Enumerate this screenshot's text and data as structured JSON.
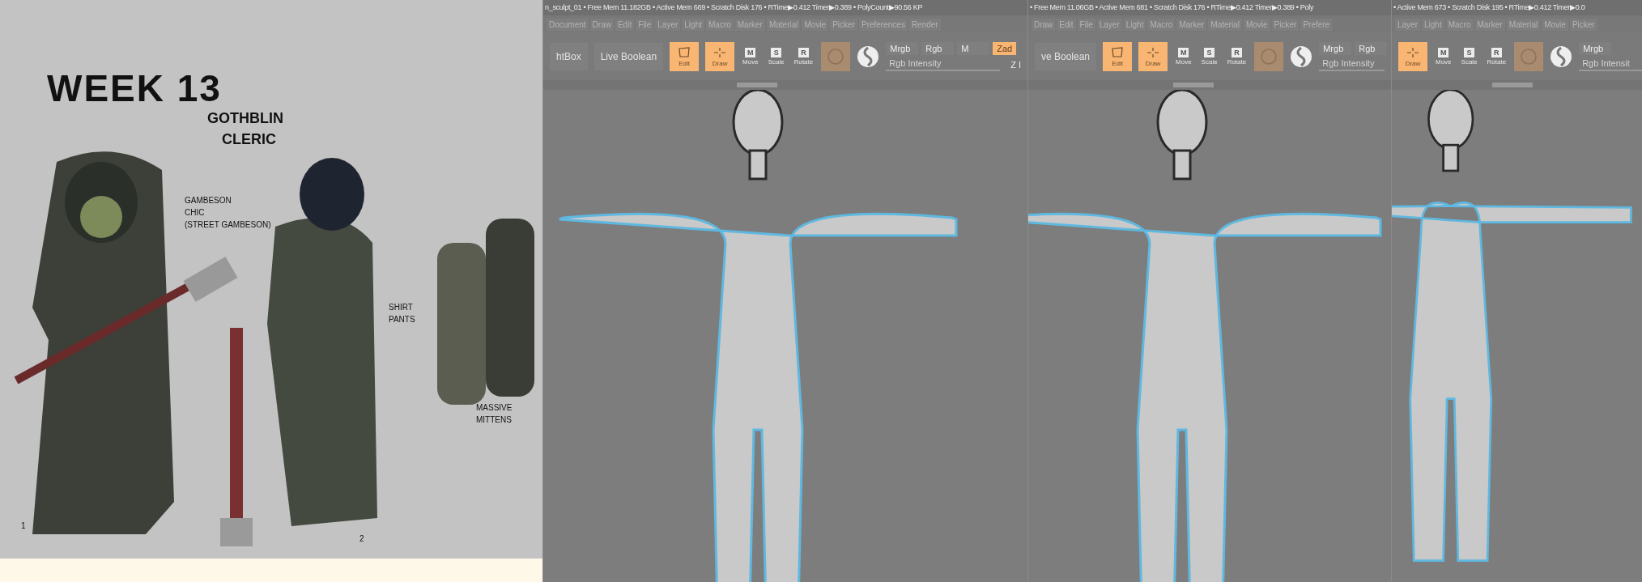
{
  "concept_art": {
    "title": "WEEK 13",
    "heading": [
      "GOTHBLIN",
      "CLERIC"
    ],
    "notes": [
      {
        "lines": [
          "GAMBESON",
          "CHIC",
          "(STREET GAMBESON)"
        ]
      },
      {
        "lines": [
          "SHIRT",
          "PANTS"
        ]
      },
      {
        "lines": [
          "MASSIVE",
          "MITTENS"
        ]
      },
      {
        "lines": [
          "1"
        ]
      },
      {
        "lines": [
          "2"
        ]
      }
    ]
  },
  "panels": [
    {
      "status": "n_sculpt_01  • Free Mem 11.182GB • Active Mem 669 • Scratch Disk 176 •  RTime▶0.412 Timer▶0.389 • PolyCount▶90.56 KP",
      "menu": [
        "Document",
        "Draw",
        "Edit",
        "File",
        "Layer",
        "Light",
        "Macro",
        "Marker",
        "Material",
        "Movie",
        "Picker",
        "Preferences",
        "Render"
      ],
      "tools": [
        {
          "kind": "textbutton",
          "label": "htBox"
        },
        {
          "kind": "textbutton",
          "label": "Live Boolean"
        },
        {
          "kind": "edit",
          "label": "Edit",
          "on": true
        },
        {
          "kind": "draw",
          "label": "Draw",
          "on": true
        },
        {
          "kind": "transform",
          "key": "M",
          "label": "Move"
        },
        {
          "kind": "transform",
          "key": "S",
          "label": "Scale"
        },
        {
          "kind": "transform",
          "key": "R",
          "label": "Rotate"
        },
        {
          "kind": "material"
        },
        {
          "kind": "sphere"
        },
        {
          "kind": "channels",
          "chips": [
            {
              "label": "Mrgb",
              "on": false
            },
            {
              "label": "Rgb",
              "on": false
            },
            {
              "label": "M",
              "on": false
            },
            {
              "label": "Zad",
              "on": true
            }
          ],
          "slider": {
            "label": "Rgb Intensity",
            "level": 0.95
          },
          "sub": "Z I"
        }
      ]
    },
    {
      "status": "• Free Mem 11.06GB • Active Mem 681 • Scratch Disk 176 •  RTime▶0.412 Timer▶0.389 • Poly",
      "menu": [
        "Draw",
        "Edit",
        "File",
        "Layer",
        "Light",
        "Macro",
        "Marker",
        "Material",
        "Movie",
        "Picker",
        "Prefere"
      ],
      "tools": [
        {
          "kind": "textbutton",
          "label": "ve Boolean"
        },
        {
          "kind": "edit",
          "label": "Edit",
          "on": true
        },
        {
          "kind": "draw",
          "label": "Draw",
          "on": true
        },
        {
          "kind": "transform",
          "key": "M",
          "label": "Move"
        },
        {
          "kind": "transform",
          "key": "S",
          "label": "Scale"
        },
        {
          "kind": "transform",
          "key": "R",
          "label": "Rotate"
        },
        {
          "kind": "material"
        },
        {
          "kind": "sphere"
        },
        {
          "kind": "channels",
          "chips": [
            {
              "label": "Mrgb",
              "on": false
            },
            {
              "label": "Rgb",
              "on": false
            }
          ],
          "slider": {
            "label": "Rgb Intensity",
            "level": 1
          }
        }
      ]
    },
    {
      "status": "• Active Mem 673 • Scratch Disk 195 •  RTime▶0.412 Timer▶0.0",
      "menu": [
        "Layer",
        "Light",
        "Macro",
        "Marker",
        "Material",
        "Movie",
        "Picker"
      ],
      "tools": [
        {
          "kind": "draw",
          "label": "Draw",
          "on": true
        },
        {
          "kind": "transform",
          "key": "M",
          "label": "Move"
        },
        {
          "kind": "transform",
          "key": "S",
          "label": "Scale"
        },
        {
          "kind": "transform",
          "key": "R",
          "label": "Rotate"
        },
        {
          "kind": "material"
        },
        {
          "kind": "sphere"
        },
        {
          "kind": "channels",
          "chips": [
            {
              "label": "Mrgb",
              "on": false
            }
          ],
          "slider": {
            "label": "Rgb Intensit",
            "level": 1
          }
        }
      ]
    }
  ]
}
